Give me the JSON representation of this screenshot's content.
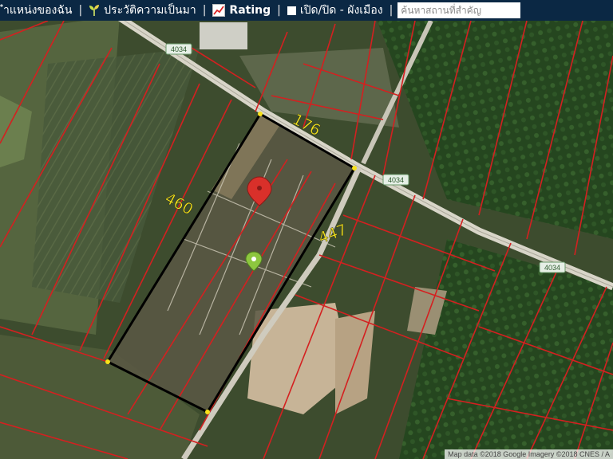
{
  "toolbar": {
    "my_location_label": "ำแหน่งของฉัน",
    "history_label": "ประวัติความเป็นมา",
    "rating_label": "Rating",
    "zoning_label": "เปิด/ปิด - ผังเมือง",
    "separator": "|",
    "search_placeholder": "ค้นหาสถานที่สำคัญ"
  },
  "map": {
    "plot_dimensions": {
      "top": "176",
      "left": "460",
      "right": "447"
    },
    "road_shields": [
      "4034",
      "4034",
      "4034"
    ],
    "attribution": "Map data ©2018 Google Imagery ©2018 CNES / A"
  },
  "colors": {
    "toolbar_bg": "#0b2844",
    "parcel_line": "#d42020",
    "plot_border": "#000000",
    "dimension_text": "#f2e31c",
    "pin_red": "#d9302a",
    "pin_green": "#8dc63f"
  },
  "icons": [
    "seedling-icon",
    "chart-icon",
    "square-icon",
    "location-pin-icon"
  ]
}
